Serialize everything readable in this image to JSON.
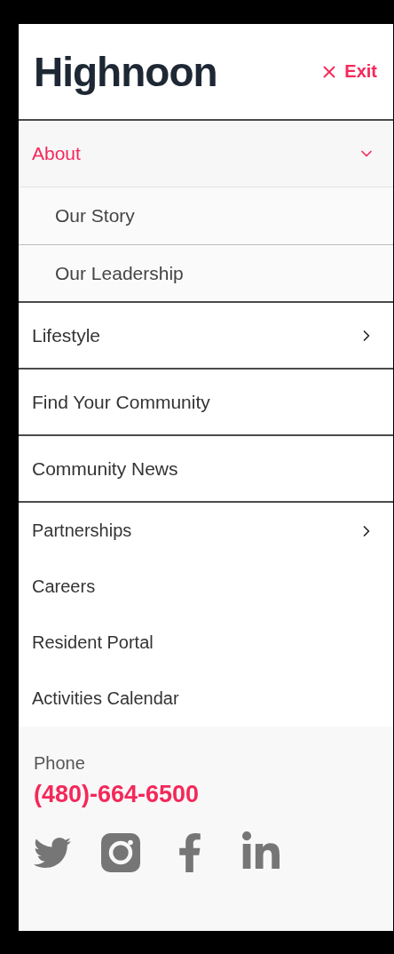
{
  "header": {
    "logo": "Highnoon",
    "exit_label": "Exit"
  },
  "primary_items": [
    {
      "kind": "accordion",
      "label": "About",
      "expanded": true,
      "children": [
        {
          "label": "Our Story"
        },
        {
          "label": "Our Leadership"
        }
      ]
    },
    {
      "kind": "submenu",
      "label": "Lifestyle"
    },
    {
      "kind": "link",
      "label": "Find Your Community"
    },
    {
      "kind": "link",
      "label": "Community News"
    }
  ],
  "secondary_items": [
    {
      "kind": "submenu",
      "label": "Partnerships"
    },
    {
      "kind": "link",
      "label": "Careers"
    },
    {
      "kind": "link",
      "label": "Resident Portal"
    },
    {
      "kind": "link",
      "label": "Activities Calendar"
    }
  ],
  "footer": {
    "phone_label": "Phone",
    "phone": "(480)-664-6500",
    "social": [
      {
        "kind": "twitter"
      },
      {
        "kind": "instagram"
      },
      {
        "kind": "facebook"
      },
      {
        "kind": "linkedin"
      }
    ]
  }
}
